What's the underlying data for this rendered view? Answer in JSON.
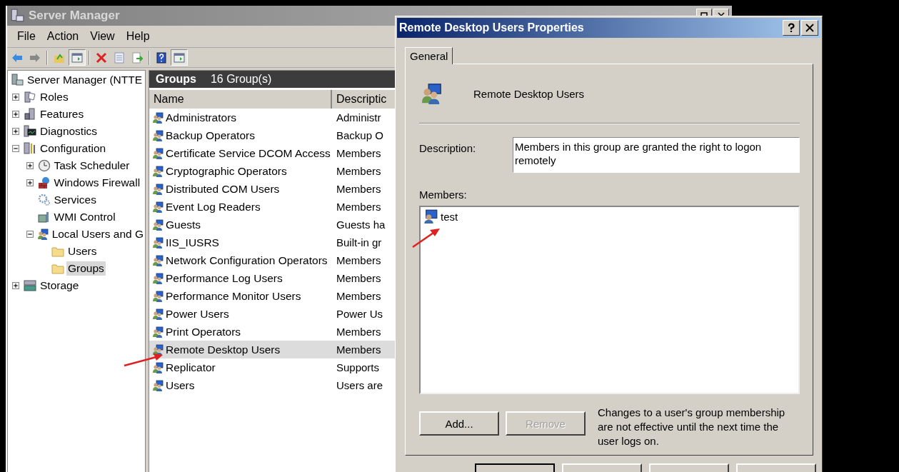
{
  "main_window": {
    "title": "Server Manager",
    "active": false
  },
  "menu": [
    "File",
    "Action",
    "View",
    "Help"
  ],
  "toolbar": [
    {
      "kind": "back",
      "pressed": false
    },
    {
      "kind": "forward",
      "pressed": false
    },
    {
      "kind": "sep"
    },
    {
      "kind": "up",
      "pressed": false
    },
    {
      "kind": "tree",
      "pressed": true
    },
    {
      "kind": "sep"
    },
    {
      "kind": "delete",
      "pressed": false
    },
    {
      "kind": "properties",
      "pressed": false
    },
    {
      "kind": "export",
      "pressed": false
    },
    {
      "kind": "sep"
    },
    {
      "kind": "help",
      "pressed": false
    },
    {
      "kind": "actionpane",
      "pressed": true
    }
  ],
  "tree": [
    {
      "label": "Server Manager (NTTE",
      "kind": "server",
      "selected": false,
      "children": [
        {
          "label": "Roles",
          "kind": "roles",
          "expanded": false,
          "selected": false
        },
        {
          "label": "Features",
          "kind": "features",
          "expanded": false,
          "selected": false
        },
        {
          "label": "Diagnostics",
          "kind": "diagnostics",
          "expanded": false,
          "selected": false
        },
        {
          "label": "Configuration",
          "kind": "configuration",
          "expanded": true,
          "selected": false,
          "children": [
            {
              "label": "Task Scheduler",
              "kind": "clock",
              "expanded": false,
              "selected": false
            },
            {
              "label": "Windows Firewall",
              "kind": "firewall",
              "expanded": false,
              "selected": false
            },
            {
              "label": "Services",
              "kind": "services",
              "selected": false
            },
            {
              "label": "WMI Control",
              "kind": "wmi",
              "selected": false
            },
            {
              "label": "Local Users and G",
              "kind": "users",
              "expanded": true,
              "selected": false,
              "children": [
                {
                  "label": "Users",
                  "kind": "folder",
                  "selected": false
                },
                {
                  "label": "Groups",
                  "kind": "folder",
                  "selected": true
                }
              ]
            }
          ]
        },
        {
          "label": "Storage",
          "kind": "storage",
          "expanded": false,
          "selected": false
        }
      ]
    }
  ],
  "groups_pane": {
    "title": "Groups",
    "count": "16 Group(s)",
    "columns": [
      "Name",
      "Descriptic"
    ],
    "rows": [
      {
        "name": "Administrators",
        "description": "Administr",
        "selected": false
      },
      {
        "name": "Backup Operators",
        "description": "Backup O",
        "selected": false
      },
      {
        "name": "Certificate Service DCOM Access",
        "description": "Members",
        "selected": false
      },
      {
        "name": "Cryptographic Operators",
        "description": "Members",
        "selected": false
      },
      {
        "name": "Distributed COM Users",
        "description": "Members",
        "selected": false
      },
      {
        "name": "Event Log Readers",
        "description": "Members",
        "selected": false
      },
      {
        "name": "Guests",
        "description": "Guests ha",
        "selected": false
      },
      {
        "name": "IIS_IUSRS",
        "description": "Built-in gr",
        "selected": false
      },
      {
        "name": "Network Configuration Operators",
        "description": "Members",
        "selected": false
      },
      {
        "name": "Performance Log Users",
        "description": "Members",
        "selected": false
      },
      {
        "name": "Performance Monitor Users",
        "description": "Members",
        "selected": false
      },
      {
        "name": "Power Users",
        "description": "Power Us",
        "selected": false
      },
      {
        "name": "Print Operators",
        "description": "Members",
        "selected": false
      },
      {
        "name": "Remote Desktop Users",
        "description": "Members",
        "selected": true
      },
      {
        "name": "Replicator",
        "description": "Supports",
        "selected": false
      },
      {
        "name": "Users",
        "description": "Users are",
        "selected": false
      }
    ]
  },
  "dialog": {
    "title": "Remote Desktop Users Properties",
    "tabs": [
      {
        "label": "General",
        "selected": true
      }
    ],
    "group_name": "Remote Desktop Users",
    "description_label": "Description:",
    "description": "Members in this group are granted the right to logon remotely",
    "members_label": "Members:",
    "members": [
      {
        "name": "test",
        "selected": false
      }
    ],
    "buttons": [
      {
        "label": "Add...",
        "disabled": false
      },
      {
        "label": "Remove",
        "disabled": true
      }
    ],
    "note": "Changes to a user's group membership are not effective until the next time the user logs on."
  }
}
